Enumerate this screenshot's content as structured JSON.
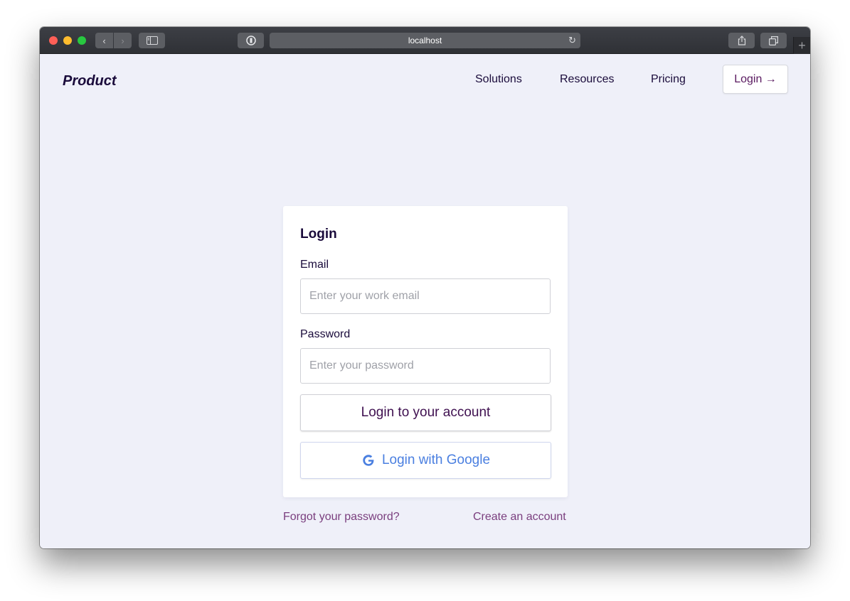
{
  "browser": {
    "address": "localhost",
    "back_symbol": "‹",
    "forward_symbol": "›",
    "reload_symbol": "↻",
    "newtab_symbol": "+"
  },
  "header": {
    "brand": "Product",
    "nav": {
      "solutions": "Solutions",
      "resources": "Resources",
      "pricing": "Pricing"
    },
    "login_button": "Login →"
  },
  "login_card": {
    "title": "Login",
    "email_label": "Email",
    "email_placeholder": "Enter your work email",
    "email_value": "",
    "password_label": "Password",
    "password_placeholder": "Enter your password",
    "password_value": "",
    "submit_label": "Login to your account",
    "google_label": "Login with Google",
    "google_icon": "google-g-icon"
  },
  "footer_links": {
    "forgot": "Forgot your password?",
    "create": "Create an account"
  },
  "colors": {
    "page_background": "#eff0f9",
    "brand_text": "#1a0b3b",
    "primary_button_text": "#3f1050",
    "google_blue": "#4a7fe0",
    "link_color": "#7a3e7e"
  }
}
